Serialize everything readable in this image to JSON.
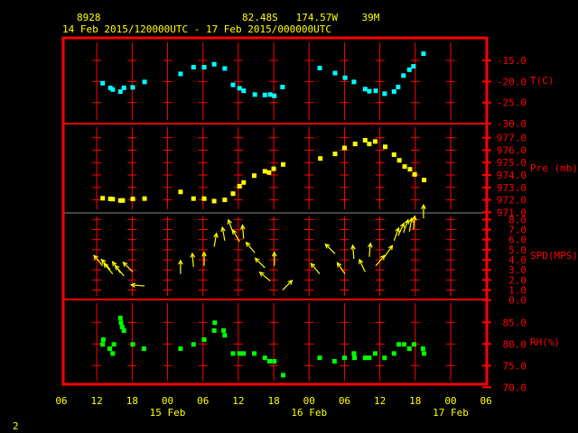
{
  "header": {
    "station": "8928",
    "location": "82.48S   174.57W    39M",
    "period": "14 Feb 2015/120000UTC - 17 Feb 2015/000000UTC"
  },
  "footer": {
    "page": "2"
  },
  "colors": {
    "frame": "#ff0000",
    "text": "#ffff00",
    "temp": "#00ffff",
    "pressure": "#ffff00",
    "wind": "#ffff00",
    "rh": "#00ff00"
  },
  "chart_data": {
    "type": "scatter",
    "x_unit": "hours since 14 Feb 06 UTC",
    "xlim": [
      0,
      72
    ],
    "x_tick_labels": [
      "06",
      "12",
      "18",
      "00",
      "06",
      "12",
      "18",
      "00",
      "06",
      "12",
      "18",
      "00",
      "06"
    ],
    "day_labels": [
      {
        "label": "15 Feb",
        "hour": 18
      },
      {
        "label": "16 Feb",
        "hour": 42
      },
      {
        "label": "17 Feb",
        "hour": 66
      }
    ],
    "panels": [
      {
        "name": "temperature",
        "label": "T(C)",
        "ylim": [
          -30,
          -12
        ],
        "ticks": [
          "-15.0",
          "-20.0",
          "-25.0",
          "-30.0"
        ],
        "tick_values": [
          -15,
          -20,
          -25,
          -30
        ],
        "points": [
          [
            7.0,
            -20.4
          ],
          [
            8.3,
            -21.5
          ],
          [
            8.7,
            -21.9
          ],
          [
            10.0,
            -22.4
          ],
          [
            10.6,
            -21.5
          ],
          [
            12.1,
            -21.4
          ],
          [
            14.1,
            -20.1
          ],
          [
            20.2,
            -18.2
          ],
          [
            22.4,
            -16.6
          ],
          [
            24.2,
            -16.6
          ],
          [
            25.9,
            -15.9
          ],
          [
            27.7,
            -16.9
          ],
          [
            29.1,
            -20.8
          ],
          [
            30.2,
            -21.6
          ],
          [
            30.9,
            -22.2
          ],
          [
            32.8,
            -23.1
          ],
          [
            34.5,
            -23.2
          ],
          [
            35.4,
            -23.1
          ],
          [
            36.1,
            -23.4
          ],
          [
            37.5,
            -21.3
          ],
          [
            43.8,
            -16.8
          ],
          [
            46.4,
            -18.0
          ],
          [
            48.1,
            -19.1
          ],
          [
            49.6,
            -20.1
          ],
          [
            51.5,
            -21.8
          ],
          [
            52.2,
            -22.3
          ],
          [
            53.3,
            -22.2
          ],
          [
            54.8,
            -22.9
          ],
          [
            56.4,
            -22.4
          ],
          [
            57.1,
            -21.3
          ],
          [
            58.0,
            -18.6
          ],
          [
            59.0,
            -17.2
          ],
          [
            59.7,
            -16.4
          ],
          [
            61.4,
            -13.4
          ]
        ]
      },
      {
        "name": "pressure",
        "label": "Pre (mb)",
        "ylim": [
          971,
          978
        ],
        "ticks": [
          "977.0",
          "976.0",
          "975.0",
          "974.0",
          "973.0",
          "972.0",
          "971.0"
        ],
        "tick_values": [
          977,
          976,
          975,
          974,
          973,
          972,
          971
        ],
        "points": [
          [
            7.0,
            972.13
          ],
          [
            8.3,
            972.08
          ],
          [
            8.7,
            972.06
          ],
          [
            10.0,
            971.95
          ],
          [
            10.4,
            971.95
          ],
          [
            12.1,
            972.08
          ],
          [
            14.1,
            972.1
          ],
          [
            20.2,
            972.64
          ],
          [
            22.4,
            972.1
          ],
          [
            24.2,
            972.1
          ],
          [
            25.9,
            971.9
          ],
          [
            27.7,
            972.0
          ],
          [
            29.1,
            972.5
          ],
          [
            30.2,
            973.1
          ],
          [
            30.9,
            973.4
          ],
          [
            32.7,
            973.95
          ],
          [
            34.5,
            974.3
          ],
          [
            35.2,
            974.2
          ],
          [
            36.0,
            974.5
          ],
          [
            37.6,
            974.85
          ],
          [
            43.9,
            975.33
          ],
          [
            46.4,
            975.7
          ],
          [
            48.0,
            976.18
          ],
          [
            49.8,
            976.5
          ],
          [
            51.5,
            976.8
          ],
          [
            52.2,
            976.5
          ],
          [
            53.2,
            976.7
          ],
          [
            54.9,
            976.27
          ],
          [
            56.4,
            975.64
          ],
          [
            57.3,
            975.18
          ],
          [
            58.2,
            974.68
          ],
          [
            59.1,
            974.46
          ],
          [
            59.9,
            974.05
          ],
          [
            61.5,
            973.6
          ]
        ]
      },
      {
        "name": "wind",
        "label": "SPD(MPS)",
        "ylim": [
          0,
          8.6
        ],
        "ticks": [
          "8.0",
          "7.0",
          "6.0",
          "5.0",
          "4.0",
          "3.0",
          "2.0",
          "1.0",
          "0.0"
        ],
        "tick_values": [
          8,
          7,
          6,
          5,
          4,
          3,
          2,
          1,
          0
        ],
        "points": [
          [
            7.0,
            3.4,
            320
          ],
          [
            8.3,
            3.0,
            320
          ],
          [
            8.7,
            2.6,
            320
          ],
          [
            10.0,
            2.7,
            325
          ],
          [
            10.6,
            2.4,
            320
          ],
          [
            12.1,
            2.8,
            315
          ],
          [
            14.1,
            1.4,
            275
          ],
          [
            20.2,
            2.6,
            0
          ],
          [
            22.4,
            3.3,
            355
          ],
          [
            24.2,
            3.4,
            0
          ],
          [
            25.9,
            5.3,
            10
          ],
          [
            27.7,
            5.9,
            350
          ],
          [
            29.1,
            6.7,
            340
          ],
          [
            30.2,
            5.8,
            330
          ],
          [
            30.9,
            6.1,
            355
          ],
          [
            32.8,
            4.7,
            320
          ],
          [
            34.5,
            3.2,
            315
          ],
          [
            35.4,
            1.9,
            310
          ],
          [
            36.1,
            3.4,
            0
          ],
          [
            37.5,
            1.0,
            45
          ],
          [
            43.8,
            2.6,
            320
          ],
          [
            46.4,
            4.6,
            315
          ],
          [
            48.1,
            2.6,
            325
          ],
          [
            49.6,
            4.1,
            355
          ],
          [
            51.5,
            2.8,
            335
          ],
          [
            52.2,
            4.3,
            5
          ],
          [
            53.3,
            3.4,
            40
          ],
          [
            54.8,
            4.3,
            35
          ],
          [
            56.4,
            5.9,
            20
          ],
          [
            57.1,
            6.4,
            25
          ],
          [
            58.0,
            6.7,
            20
          ],
          [
            59.0,
            6.8,
            10
          ],
          [
            59.7,
            7.0,
            5
          ],
          [
            61.4,
            8.1,
            0
          ]
        ]
      },
      {
        "name": "humidity",
        "label": "RH(%)",
        "ylim": [
          70,
          88
        ],
        "ticks": [
          "85.0",
          "80.0",
          "75.0",
          "70.0"
        ],
        "tick_values": [
          85,
          80,
          75,
          70
        ],
        "points": [
          [
            7.1,
            81.0
          ],
          [
            7.0,
            79.9
          ],
          [
            8.2,
            78.9
          ],
          [
            8.7,
            77.8
          ],
          [
            8.9,
            79.9
          ],
          [
            10.0,
            86.0
          ],
          [
            10.1,
            84.9
          ],
          [
            10.3,
            83.9
          ],
          [
            10.6,
            83.1
          ],
          [
            12.1,
            79.9
          ],
          [
            14.0,
            78.9
          ],
          [
            20.2,
            78.9
          ],
          [
            22.4,
            79.9
          ],
          [
            24.2,
            81.0
          ],
          [
            25.9,
            83.1
          ],
          [
            26.0,
            84.9
          ],
          [
            27.5,
            83.1
          ],
          [
            27.7,
            82.0
          ],
          [
            29.1,
            77.8
          ],
          [
            30.2,
            77.8
          ],
          [
            30.9,
            77.8
          ],
          [
            32.7,
            77.8
          ],
          [
            34.5,
            76.8
          ],
          [
            35.3,
            76.0
          ],
          [
            36.1,
            76.0
          ],
          [
            37.6,
            72.8
          ],
          [
            43.8,
            76.8
          ],
          [
            46.3,
            76.0
          ],
          [
            48.0,
            76.8
          ],
          [
            49.6,
            77.8
          ],
          [
            49.7,
            76.8
          ],
          [
            51.5,
            76.8
          ],
          [
            52.2,
            76.8
          ],
          [
            53.2,
            77.8
          ],
          [
            54.8,
            76.8
          ],
          [
            56.4,
            77.8
          ],
          [
            57.2,
            79.9
          ],
          [
            58.1,
            79.9
          ],
          [
            59.0,
            78.9
          ],
          [
            59.8,
            79.9
          ],
          [
            61.3,
            78.9
          ],
          [
            61.5,
            77.8
          ]
        ]
      }
    ]
  }
}
